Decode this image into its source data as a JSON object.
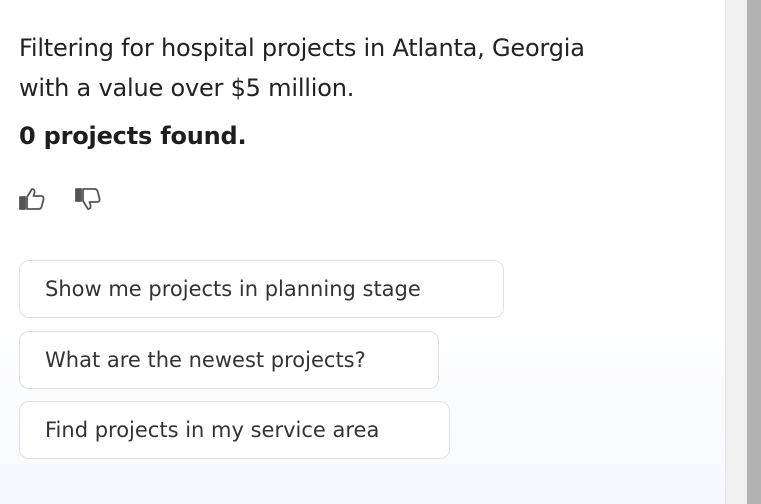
{
  "chat": {
    "message": "Filtering for hospital projects in Atlanta, Georgia with a value over $5 million.",
    "result": "0 projects found."
  },
  "feedback": {
    "thumbs_up_icon": "thumbs-up-icon",
    "thumbs_down_icon": "thumbs-down-icon"
  },
  "suggestions": [
    {
      "label": "Show me projects in planning stage"
    },
    {
      "label": "What are the newest projects?"
    },
    {
      "label": "Find projects in my service area"
    }
  ],
  "colors": {
    "text": "#222222",
    "icon": "#555555",
    "chip_border": "#e0e0e0",
    "scrollbar": "#b3b3b3"
  }
}
